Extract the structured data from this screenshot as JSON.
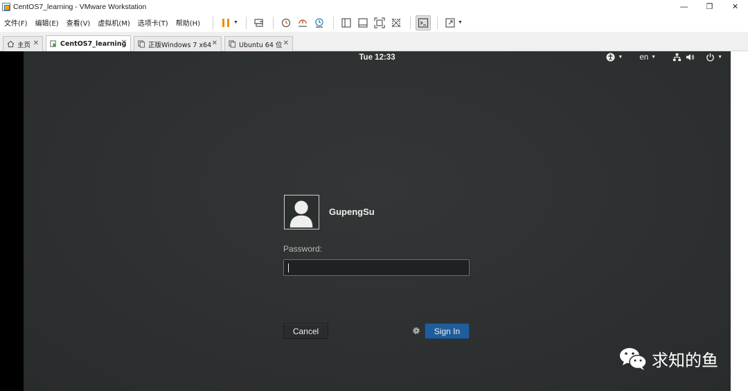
{
  "window": {
    "title": "CentOS7_learning - VMware Workstation",
    "controls": {
      "minimize": "—",
      "restore": "❐",
      "close": "✕"
    }
  },
  "menu": {
    "items": [
      "文件(F)",
      "编辑(E)",
      "查看(V)",
      "虚拟机(M)",
      "选项卡(T)",
      "帮助(H)"
    ]
  },
  "toolbar": {
    "icons": [
      "pause-icon",
      "send-keys-icon",
      "snapshot-icon",
      "revert-snapshot-icon",
      "snapshot-manager-icon",
      "library-icon",
      "thumbnail-icon",
      "fullscreen-icon",
      "unity-icon",
      "console-icon",
      "stretch-icon"
    ],
    "accent": "#f08a00"
  },
  "tabs": [
    {
      "label": "主页",
      "icon": "home-icon",
      "close": "✕",
      "active": false
    },
    {
      "label": "CentOS7_learning",
      "icon": "vm-running-icon",
      "close": "✕",
      "active": true
    },
    {
      "label": "正版Windows 7 x64",
      "icon": "vm-icon",
      "close": "✕",
      "active": false
    },
    {
      "label": "Ubuntu 64 位",
      "icon": "vm-icon",
      "close": "✕",
      "active": false
    }
  ],
  "vm": {
    "topbar": {
      "clock": "Tue 12:33",
      "language": "en",
      "caret": "▼",
      "icons": [
        "accessibility-icon",
        "network-icon",
        "volume-icon",
        "power-icon"
      ]
    },
    "login": {
      "username": "GupengSu",
      "password_label": "Password:",
      "password_value": "",
      "cancel_label": "Cancel",
      "signin_label": "Sign In"
    },
    "colors": {
      "background": "#2e3132",
      "signin": "#215d9c"
    }
  },
  "watermark": {
    "text": "求知的鱼"
  }
}
